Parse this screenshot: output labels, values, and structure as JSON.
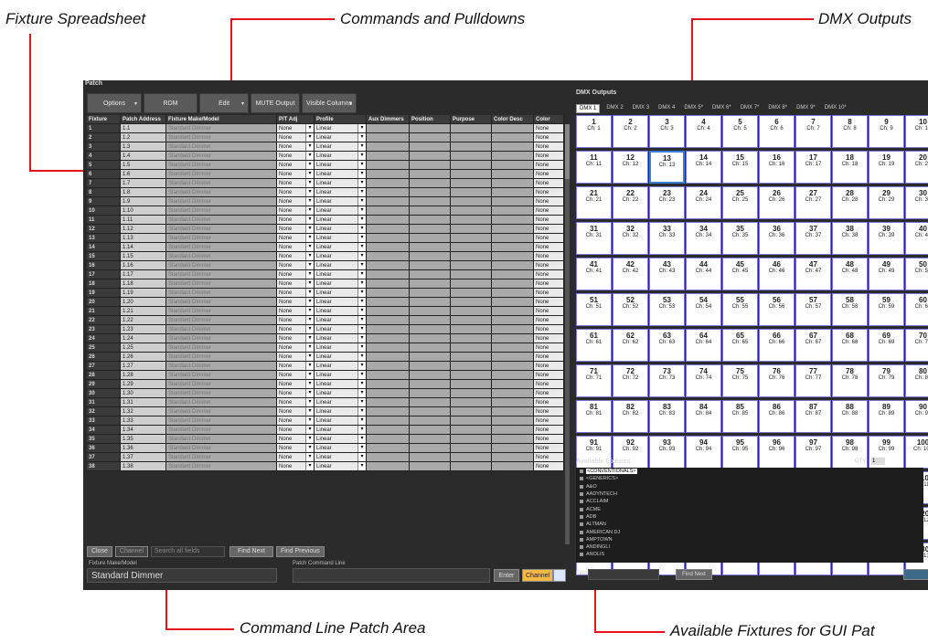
{
  "callouts": {
    "fixture_spreadsheet": "Fixture Spreadsheet",
    "commands_pulldowns": "Commands and Pulldowns",
    "dmx_outputs": "DMX Outputs",
    "command_line_patch": "Command Line Patch Area",
    "available_fixtures": "Available Fixtures for GUI Pat"
  },
  "window": {
    "title": "Patch"
  },
  "toolbar": {
    "options": "Options",
    "rdm": "RDM",
    "edit": "Edit",
    "mute": "MUTE Output",
    "visible_columns": "Visible Columns",
    "dropdown_glyph": "▾"
  },
  "table": {
    "headers": [
      "Fixture",
      "Patch Address",
      "Fixture Make/Model",
      "P/T Adj",
      "Profile",
      "Aux Dimmers",
      "Position",
      "Purpose",
      "Color Desc",
      "Color"
    ],
    "rows": [
      [
        "1",
        "1.1",
        "Standard Dimmer",
        "None",
        "Linear",
        "None"
      ],
      [
        "2",
        "1.2",
        "Standard Dimmer",
        "None",
        "Linear",
        "None"
      ],
      [
        "3",
        "1.3",
        "Standard Dimmer",
        "None",
        "Linear",
        "None"
      ],
      [
        "4",
        "1.4",
        "Standard Dimmer",
        "None",
        "Linear",
        "None"
      ],
      [
        "5",
        "1.5",
        "Standard Dimmer",
        "None",
        "Linear",
        "None"
      ],
      [
        "6",
        "1.6",
        "Standard Dimmer",
        "None",
        "Linear",
        "None"
      ],
      [
        "7",
        "1.7",
        "Standard Dimmer",
        "None",
        "Linear",
        "None"
      ],
      [
        "8",
        "1.8",
        "Standard Dimmer",
        "None",
        "Linear",
        "None"
      ],
      [
        "9",
        "1.9",
        "Standard Dimmer",
        "None",
        "Linear",
        "None"
      ],
      [
        "10",
        "1.10",
        "Standard Dimmer",
        "None",
        "Linear",
        "None"
      ],
      [
        "11",
        "1.11",
        "Standard Dimmer",
        "None",
        "Linear",
        "None"
      ],
      [
        "12",
        "1.12",
        "Standard Dimmer",
        "None",
        "Linear",
        "None"
      ],
      [
        "13",
        "1.13",
        "Standard Dimmer",
        "None",
        "Linear",
        "None"
      ],
      [
        "14",
        "1.14",
        "Standard Dimmer",
        "None",
        "Linear",
        "None"
      ],
      [
        "15",
        "1.15",
        "Standard Dimmer",
        "None",
        "Linear",
        "None"
      ],
      [
        "16",
        "1.16",
        "Standard Dimmer",
        "None",
        "Linear",
        "None"
      ],
      [
        "17",
        "1.17",
        "Standard Dimmer",
        "None",
        "Linear",
        "None"
      ],
      [
        "18",
        "1.18",
        "Standard Dimmer",
        "None",
        "Linear",
        "None"
      ],
      [
        "19",
        "1.19",
        "Standard Dimmer",
        "None",
        "Linear",
        "None"
      ],
      [
        "20",
        "1.20",
        "Standard Dimmer",
        "None",
        "Linear",
        "None"
      ],
      [
        "21",
        "1.21",
        "Standard Dimmer",
        "None",
        "Linear",
        "None"
      ],
      [
        "22",
        "1.22",
        "Standard Dimmer",
        "None",
        "Linear",
        "None"
      ],
      [
        "23",
        "1.23",
        "Standard Dimmer",
        "None",
        "Linear",
        "None"
      ],
      [
        "24",
        "1.24",
        "Standard Dimmer",
        "None",
        "Linear",
        "None"
      ],
      [
        "25",
        "1.25",
        "Standard Dimmer",
        "None",
        "Linear",
        "None"
      ],
      [
        "26",
        "1.26",
        "Standard Dimmer",
        "None",
        "Linear",
        "None"
      ],
      [
        "27",
        "1.27",
        "Standard Dimmer",
        "None",
        "Linear",
        "None"
      ],
      [
        "28",
        "1.28",
        "Standard Dimmer",
        "None",
        "Linear",
        "None"
      ],
      [
        "29",
        "1.29",
        "Standard Dimmer",
        "None",
        "Linear",
        "None"
      ],
      [
        "30",
        "1.30",
        "Standard Dimmer",
        "None",
        "Linear",
        "None"
      ],
      [
        "31",
        "1.31",
        "Standard Dimmer",
        "None",
        "Linear",
        "None"
      ],
      [
        "32",
        "1.32",
        "Standard Dimmer",
        "None",
        "Linear",
        "None"
      ],
      [
        "33",
        "1.33",
        "Standard Dimmer",
        "None",
        "Linear",
        "None"
      ],
      [
        "34",
        "1.34",
        "Standard Dimmer",
        "None",
        "Linear",
        "None"
      ],
      [
        "35",
        "1.35",
        "Standard Dimmer",
        "None",
        "Linear",
        "None"
      ],
      [
        "36",
        "1.36",
        "Standard Dimmer",
        "None",
        "Linear",
        "None"
      ],
      [
        "37",
        "1.37",
        "Standard Dimmer",
        "None",
        "Linear",
        "None"
      ],
      [
        "38",
        "1.38",
        "Standard Dimmer",
        "None",
        "Linear",
        "None"
      ]
    ]
  },
  "search": {
    "close": "Close",
    "channel": "Channel",
    "placeholder": "Search all fields",
    "find_next": "Find Next",
    "find_previous": "Find Previous"
  },
  "patch_area": {
    "make_label": "Fixture Make/Model",
    "make_value": "Standard Dimmer",
    "cmd_label": "Patch Command Line",
    "enter": "Enter",
    "channel": "Channel"
  },
  "dmx": {
    "title": "DMX Outputs",
    "tabs": [
      "DMX 1",
      "DMX 2",
      "DMX 3",
      "DMX 4",
      "DMX 5*",
      "DMX 6*",
      "DMX 7*",
      "DMX 8*",
      "DMX 9*",
      "DMX 10*"
    ],
    "channel_prefix": "Ch: ",
    "channel_count": 130
  },
  "available": {
    "title": "Available Fixtures",
    "qty_label": "QTY",
    "qty_value": "1",
    "items": [
      "<CONVENTIONALS>",
      "<GENERICS>",
      "A&O",
      "AADYNTECH",
      "ACCLAIM",
      "ACME",
      "ADB",
      "ALTMAN",
      "AMERICAN DJ",
      "AMPTOWN",
      "ANDINGLI",
      "ANOLIS"
    ],
    "find_label": "Find:",
    "find_next": "Find Next"
  }
}
